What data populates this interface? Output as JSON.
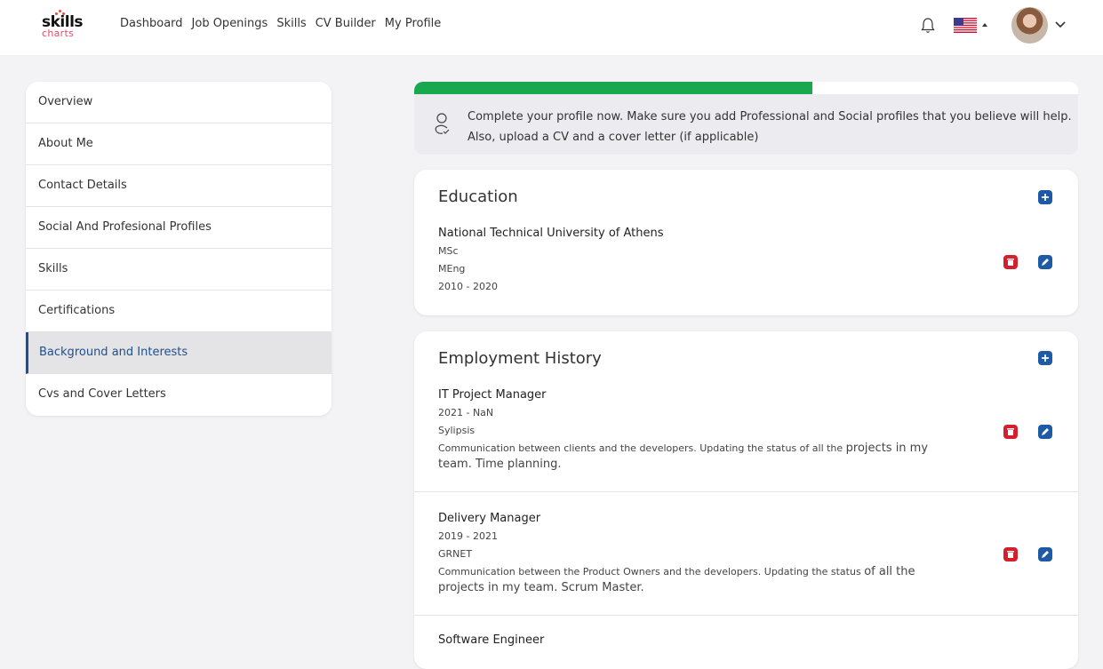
{
  "brand": {
    "logo_line1": "skills",
    "logo_line2": "charts"
  },
  "nav": [
    "Dashboard",
    "Job Openings",
    "Skills",
    "CV Builder",
    "My Profile"
  ],
  "header_icons": [
    "bell-icon",
    "us-flag-icon",
    "caret-up-icon",
    "avatar",
    "chevron-down-icon"
  ],
  "sidebar": {
    "items": [
      {
        "label": "Overview"
      },
      {
        "label": "About Me"
      },
      {
        "label": "Contact Details"
      },
      {
        "label": "Social And Profesional Profiles"
      },
      {
        "label": "Skills"
      },
      {
        "label": "Certifications"
      },
      {
        "label": "Background and Interests",
        "active": true
      },
      {
        "label": "Cvs and Cover Letters"
      }
    ]
  },
  "profile_progress": {
    "fraction": 0.6
  },
  "notice": {
    "text": "Complete your profile now. Make sure you add Professional and Social profiles that you believe will help. Also, upload a CV and a cover letter (if applicable)"
  },
  "education": {
    "title": "Education",
    "entries": [
      {
        "school": "National Technical University of Athens",
        "degree1": "MSc",
        "degree2": "MEng",
        "years": "2010 - 2020"
      }
    ]
  },
  "employment": {
    "title": "Employment History",
    "entries": [
      {
        "role": "IT Project Manager",
        "years": "2021 - NaN",
        "company": "Sylipsis",
        "desc_small": "Communication between clients and the developers. Updating the status of all the ",
        "desc_big": "projects in my team. Time planning."
      },
      {
        "role": "Delivery Manager",
        "years": "2019 - 2021",
        "company": "GRNET",
        "desc_small": "Communication between the Product Owners and the developers. Updating the status ",
        "desc_big": "of all the projects in my team. Scrum Master."
      },
      {
        "role": "Software Engineer"
      }
    ]
  },
  "colors": {
    "primary": "#1f5aa6",
    "danger": "#d61f2c",
    "progress": "#1aa84e",
    "active_text": "#1f4f8f",
    "background": "#f3f3f6"
  }
}
